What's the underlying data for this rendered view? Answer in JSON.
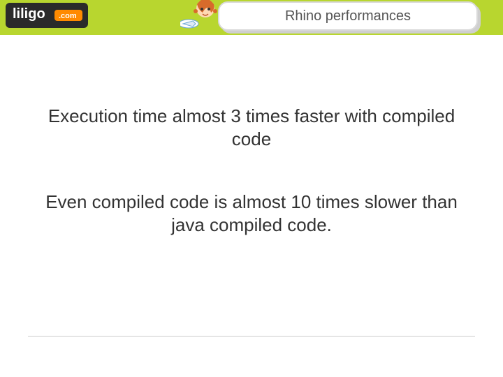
{
  "header": {
    "logo_text_main": "liligo",
    "logo_text_sub": ".com",
    "title": "Rhino performances"
  },
  "body": {
    "paragraph1": "Execution time almost 3 times faster with compiled code",
    "paragraph2": "Even compiled code is almost 10 times slower than java compiled code."
  },
  "colors": {
    "band": "#b8d62f",
    "logo_bg": "#2a2a2a",
    "logo_accent": "#ff8a00"
  }
}
